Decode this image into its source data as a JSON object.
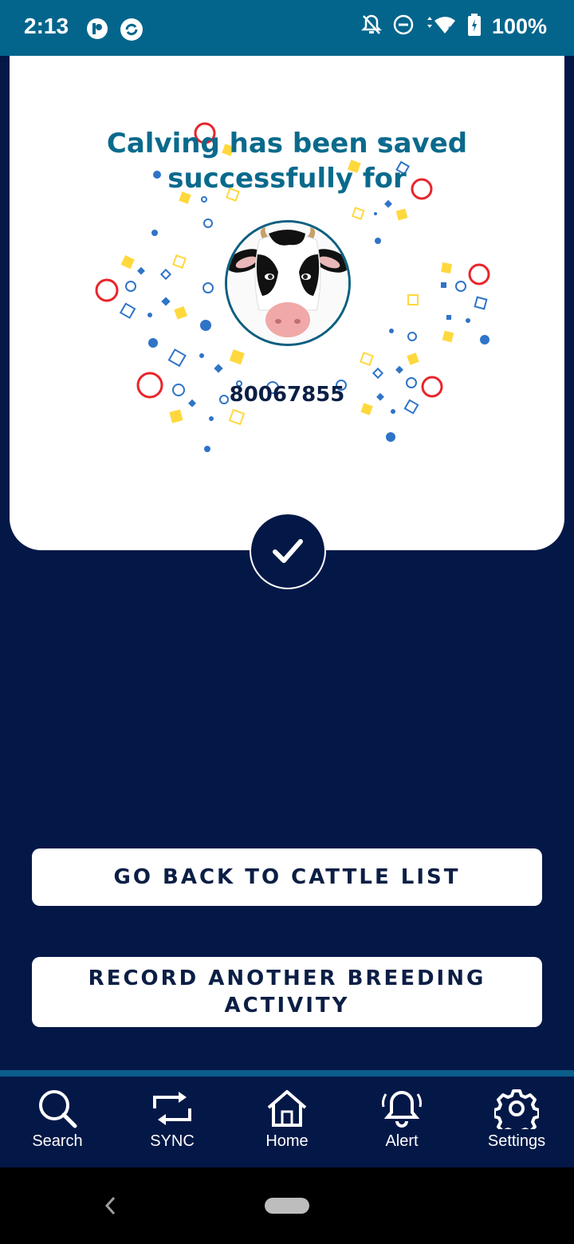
{
  "status_bar": {
    "time": "2:13",
    "battery": "100%"
  },
  "card": {
    "title": "Calving has been saved successfully for",
    "cattle_id": "80067855"
  },
  "buttons": {
    "go_back": "GO BACK TO CATTLE LIST",
    "record_another": "RECORD ANOTHER BREEDING ACTIVITY"
  },
  "bottom_nav": {
    "items": [
      {
        "label": "Search",
        "icon": "search-icon"
      },
      {
        "label": "SYNC",
        "icon": "sync-icon"
      },
      {
        "label": "Home",
        "icon": "home-icon"
      },
      {
        "label": "Alert",
        "icon": "alert-bell-icon"
      },
      {
        "label": "Settings",
        "icon": "gear-icon"
      }
    ]
  },
  "colors": {
    "status_bar": "#03658c",
    "background": "#031847",
    "title": "#0a6a8c",
    "confetti_blue": "#2f74c8",
    "confetti_yellow": "#ffd83d",
    "confetti_red": "#e8252b"
  }
}
